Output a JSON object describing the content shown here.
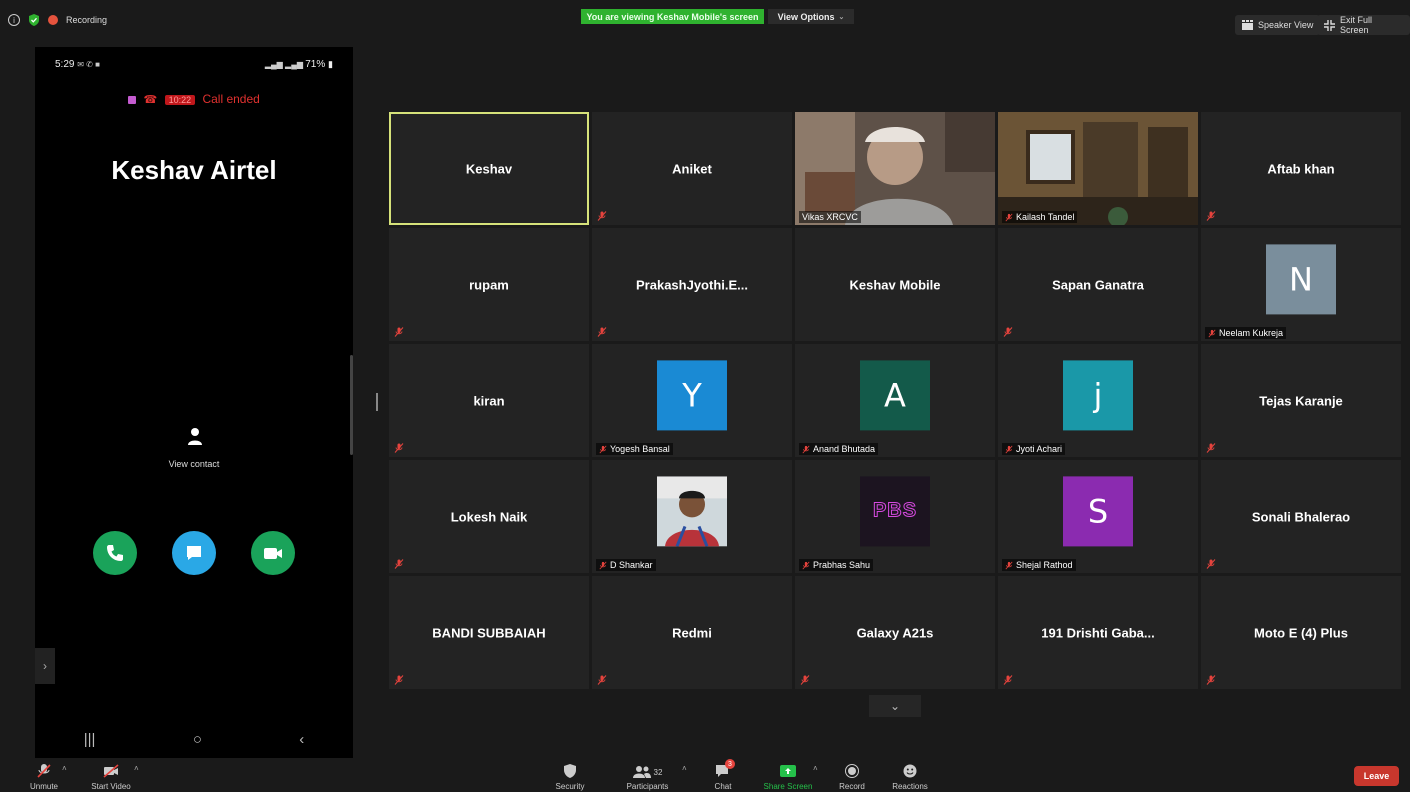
{
  "top_bar": {
    "recording_label": "Recording",
    "viewing_banner": "You are viewing Keshav Mobile's screen",
    "view_options_label": "View Options",
    "speaker_view_label": "Speaker View",
    "exit_full_screen_label": "Exit Full Screen"
  },
  "phone": {
    "time": "5:29",
    "battery": "71%",
    "status_text": "Call ended",
    "status_badge": "10:22",
    "caller_name": "Keshav Airtel",
    "view_contact_label": "View contact",
    "colors": {
      "call": "#1aa35a",
      "message": "#2aa8e6",
      "video": "#1aa35a",
      "ended": "#e0312f"
    }
  },
  "participants": [
    {
      "name": "Keshav",
      "type": "name",
      "active": true,
      "muted": false
    },
    {
      "name": "Aniket",
      "type": "name",
      "muted": true
    },
    {
      "name": "Vikas XRCVC",
      "type": "video",
      "muted": false
    },
    {
      "name": "Kailash Tandel",
      "type": "video",
      "muted": true
    },
    {
      "name": "Aftab khan",
      "type": "name",
      "muted": true
    },
    {
      "name": "rupam",
      "type": "name",
      "muted": true
    },
    {
      "name": "PrakashJyothi.E...",
      "type": "name",
      "muted": true
    },
    {
      "name": "Keshav Mobile",
      "type": "name",
      "muted": false
    },
    {
      "name": "Sapan Ganatra",
      "type": "name",
      "muted": true
    },
    {
      "name": "Neelam Kukreja",
      "type": "avatar",
      "initial": "N",
      "color": "#7a8e9c",
      "muted": true
    },
    {
      "name": "kiran",
      "type": "name",
      "muted": true
    },
    {
      "name": "Yogesh Bansal",
      "type": "avatar",
      "initial": "Y",
      "color": "#1a8ad4",
      "muted": true
    },
    {
      "name": "Anand Bhutada",
      "type": "avatar",
      "initial": "A",
      "color": "#135a4a",
      "muted": true
    },
    {
      "name": "Jyoti Achari",
      "type": "avatar",
      "initial": "j",
      "color": "#1a98a8",
      "muted": true
    },
    {
      "name": "Tejas Karanje",
      "type": "name",
      "muted": true
    },
    {
      "name": "Lokesh Naik",
      "type": "name",
      "muted": true
    },
    {
      "name": "D Shankar",
      "type": "photo",
      "muted": true
    },
    {
      "name": "Prabhas Sahu",
      "type": "logo",
      "logo_text": "PBS",
      "muted": true
    },
    {
      "name": "Shejal Rathod",
      "type": "avatar",
      "initial": "S",
      "color": "#8b2bb0",
      "muted": true
    },
    {
      "name": "Sonali Bhalerao",
      "type": "name",
      "muted": true
    },
    {
      "name": "BANDI SUBBAIAH",
      "type": "name",
      "muted": true
    },
    {
      "name": "Redmi",
      "type": "name",
      "muted": true
    },
    {
      "name": "Galaxy A21s",
      "type": "name",
      "muted": true
    },
    {
      "name": "191 Drishti Gaba...",
      "type": "name",
      "muted": true
    },
    {
      "name": "Moto E (4) Plus",
      "type": "name",
      "muted": true
    }
  ],
  "toolbar": {
    "unmute": "Unmute",
    "start_video": "Start Video",
    "security": "Security",
    "participants": "Participants",
    "participants_count": "32",
    "chat": "Chat",
    "chat_badge": "3",
    "share_screen": "Share Screen",
    "record": "Record",
    "reactions": "Reactions",
    "leave": "Leave"
  }
}
